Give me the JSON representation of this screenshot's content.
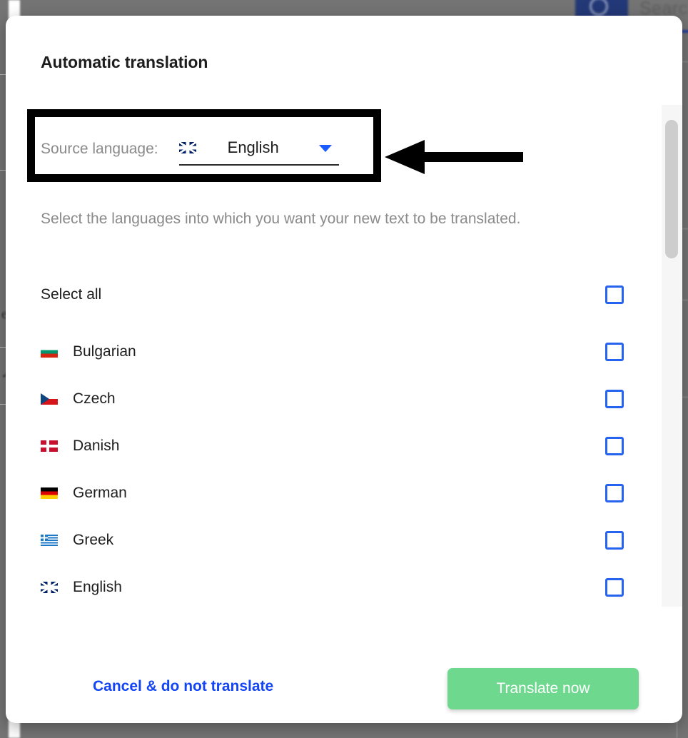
{
  "backdrop": {
    "search_button_icon": "search-icon",
    "search_placeholder_fragment": "Searc"
  },
  "modal": {
    "title": "Automatic translation",
    "source": {
      "label": "Source language:",
      "selected_value": "English",
      "selected_flag": "flag-gb",
      "caret_icon": "chevron-down-icon",
      "caret_color": "#1a5cff"
    },
    "annotation": {
      "arrow_icon": "left-arrow-annotation-icon",
      "highlight_icon": "highlight-box-annotation"
    },
    "description": "Select the languages into which you want your new text to be translated.",
    "select_all_label": "Select all",
    "languages": [
      {
        "name": "Bulgarian",
        "flag": "flag-bg",
        "checked": false
      },
      {
        "name": "Czech",
        "flag": "flag-cz",
        "checked": false
      },
      {
        "name": "Danish",
        "flag": "flag-dk",
        "checked": false
      },
      {
        "name": "German",
        "flag": "flag-de",
        "checked": false
      },
      {
        "name": "Greek",
        "flag": "flag-gr",
        "checked": false
      },
      {
        "name": "English",
        "flag": "flag-gb",
        "checked": false
      }
    ],
    "footer": {
      "cancel_label": "Cancel & do not translate",
      "translate_label": "Translate now"
    },
    "colors": {
      "accent_blue": "#1344f5",
      "checkbox_blue": "#2563f0",
      "translate_green": "#6ED98E",
      "muted_text": "#8a8a8a",
      "title_text": "#1d1d1d"
    },
    "scrollbar": {
      "thumb_color": "#cdcdcd",
      "track_color": "#f6f6f6"
    }
  }
}
